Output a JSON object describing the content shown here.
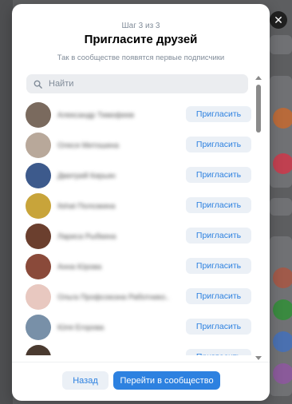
{
  "modal": {
    "step": "Шаг 3 из 3",
    "title": "Пригласите друзей",
    "subtitle": "Так в сообществе появятся первые подписчики",
    "search_placeholder": "Найти"
  },
  "friends": [
    {
      "name": "Александр Тимофеев",
      "avatar_color": "#7a6a5e",
      "invite_label": "Пригласить"
    },
    {
      "name": "Олеся Митошина",
      "avatar_color": "#b8a89a",
      "invite_label": "Пригласить"
    },
    {
      "name": "Дмитрий Кирьин",
      "avatar_color": "#3d5a8c",
      "invite_label": "Пригласить"
    },
    {
      "name": "Ilshat Полозкина",
      "avatar_color": "#c8a43a",
      "invite_label": "Пригласить"
    },
    {
      "name": "Лариса Рыбкина",
      "avatar_color": "#6b3f2e",
      "invite_label": "Пригласить"
    },
    {
      "name": "Анна Юрова",
      "avatar_color": "#8a4a3a",
      "invite_label": "Пригласить"
    },
    {
      "name": "Ольга Профсоюзна Работнико...",
      "avatar_color": "#e8c8c0",
      "invite_label": "Пригласить"
    },
    {
      "name": "Юля Егорова",
      "avatar_color": "#7890a8",
      "invite_label": "Пригласить"
    },
    {
      "name": "",
      "avatar_color": "#4a3a30",
      "invite_label": "Пригласить"
    }
  ],
  "footer": {
    "back_label": "Назад",
    "go_label": "Перейти в сообщество"
  },
  "close_label": "✕",
  "colors": {
    "accent": "#2d81e0",
    "secondary_bg": "#ebf0f6",
    "muted_text": "#818c99"
  }
}
